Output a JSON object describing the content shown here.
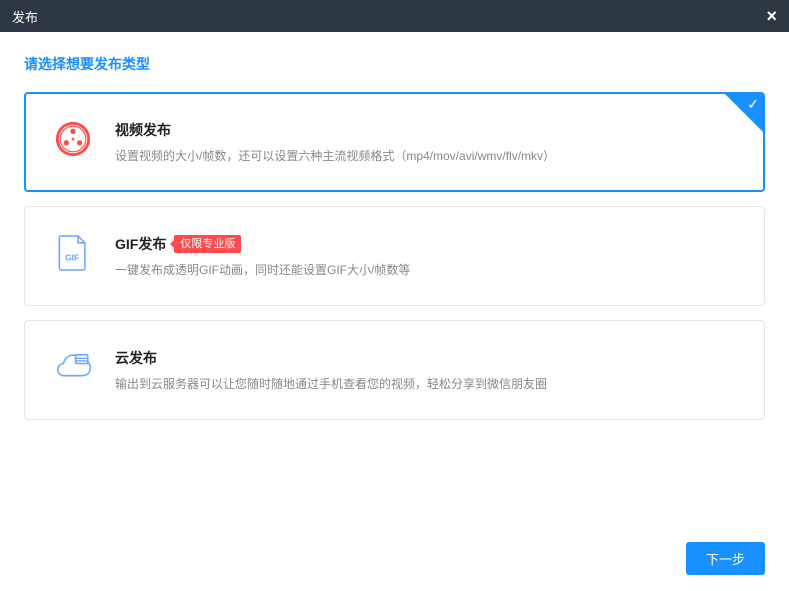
{
  "window": {
    "title": "发布",
    "close_label": "×"
  },
  "prompt": "请选择想要发布类型",
  "options": {
    "video": {
      "title": "视频发布",
      "desc": "设置视频的大小/帧数，还可以设置六种主流视频格式（mp4/mov/avi/wmv/flv/mkv）"
    },
    "gif": {
      "title": "GIF发布",
      "badge": "仅限专业版",
      "desc": "一键发布成透明GIF动画，同时还能设置GIF大小/帧数等",
      "icon_label": "GIF"
    },
    "cloud": {
      "title": "云发布",
      "desc": "输出到云服务器可以让您随时随地通过手机查看您的视频，轻松分享到微信朋友圈"
    }
  },
  "footer": {
    "next_label": "下一步"
  }
}
